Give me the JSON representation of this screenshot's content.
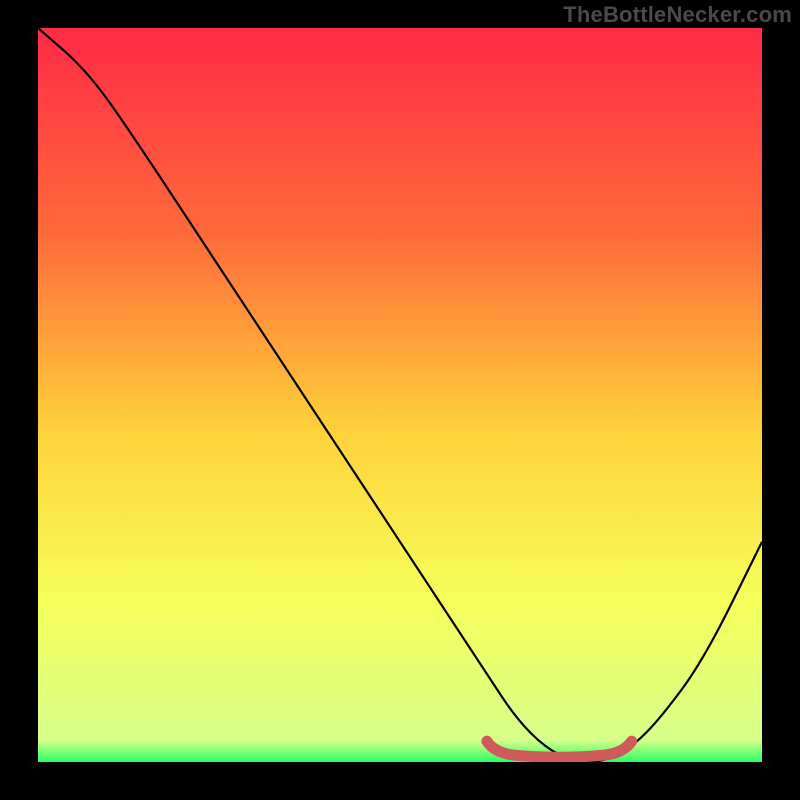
{
  "watermark": "TheBottleNecker.com",
  "colors": {
    "page_bg": "#000000",
    "grad_top": "#ff2a45",
    "grad_mid1": "#ff6a3a",
    "grad_mid2": "#ffd23a",
    "grad_mid3": "#f6ff5a",
    "grad_bottom": "#2aff64",
    "curve": "#000000",
    "accent": "#cf5a5a"
  },
  "chart_data": {
    "type": "line",
    "title": "",
    "xlabel": "",
    "ylabel": "",
    "xlim": [
      0,
      100
    ],
    "ylim": [
      0,
      100
    ],
    "series": [
      {
        "name": "curve",
        "x": [
          0,
          7,
          14,
          22,
          30,
          38,
          46,
          54,
          62,
          66,
          70,
          74,
          78,
          82,
          86,
          92,
          100
        ],
        "values": [
          100,
          94,
          84,
          72,
          60,
          48,
          36,
          24,
          12,
          6,
          2,
          0,
          0,
          2,
          6,
          14,
          30
        ]
      }
    ],
    "accent_segment": {
      "x_start": 62,
      "x_end": 82,
      "y_approx": 1.2
    }
  }
}
